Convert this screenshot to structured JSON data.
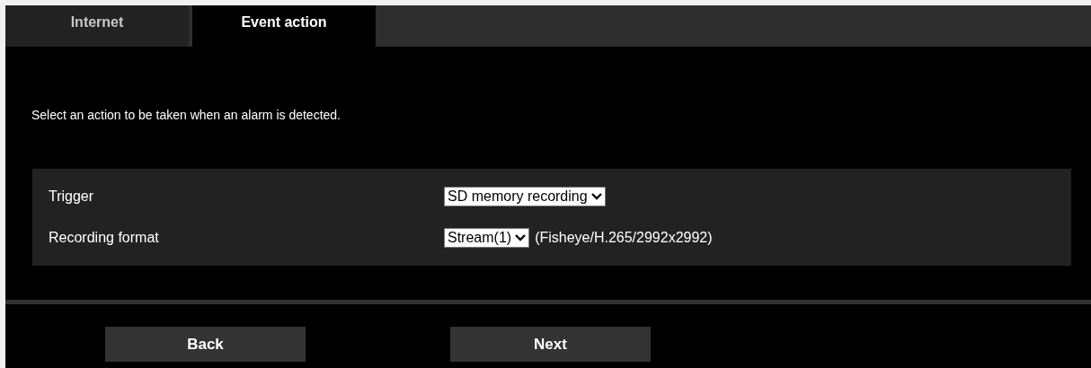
{
  "tabs": [
    {
      "label": "Internet",
      "selected": false
    },
    {
      "label": "Event action",
      "selected": true
    }
  ],
  "instruction": "Select an action to be taken when an alarm is detected.",
  "settings": [
    {
      "label": "Trigger",
      "value": "SD memory recording"
    },
    {
      "label": "Recording format",
      "value": "Stream(1)",
      "note": "(Fisheye/H.265/2992x2992)"
    }
  ],
  "buttons": [
    "Back",
    "Next"
  ]
}
